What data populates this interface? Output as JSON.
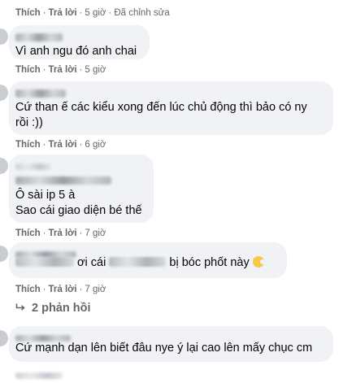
{
  "first_actions": {
    "like": "Thích",
    "reply": "Trả lời",
    "time": "5 giờ",
    "edited": "Đã chỉnh sửa"
  },
  "comments": [
    {
      "lines": [
        "Vì anh ngu đó anh chai"
      ],
      "like": "Thích",
      "reply": "Trả lời",
      "time": "5 giờ"
    },
    {
      "lines": [
        "Cứ than ế các kiểu xong đến lúc chủ động thì bảo có ny",
        "rồi :))"
      ],
      "like": "Thích",
      "reply": "Trả lời",
      "time": "6 giờ"
    },
    {
      "lines": [
        "Ô sài ip 5 à",
        "Sao cái giao diện bé thế"
      ],
      "like": "Thích",
      "reply": "Trả lời",
      "time": "7 giờ"
    },
    {
      "text_a": "ơi cái",
      "text_b": "bị bóc phốt này",
      "like": "Thích",
      "reply": "Trả lời",
      "time": "7 giờ"
    },
    {
      "lines": [
        "Cứ mạnh dạn lên biết đâu nye ý lại cao lên mấy chục cm"
      ]
    }
  ],
  "replies_label": "2 phản hồi",
  "separator": "·",
  "icons": {
    "reply_arrow": "reply-arrow-icon",
    "emoji": "emoji-icon"
  }
}
